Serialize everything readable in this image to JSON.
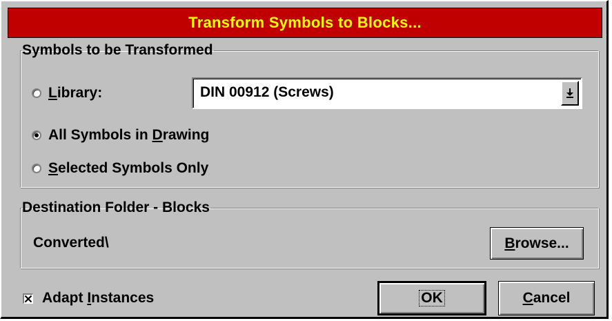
{
  "window": {
    "title": "Transform Symbols to Blocks..."
  },
  "symbols_group": {
    "legend": "Symbols to be Transformed",
    "options": [
      {
        "prefix": "",
        "underline": "L",
        "suffix": "ibrary:",
        "selected": false
      },
      {
        "prefix": "All Symbols in ",
        "underline": "D",
        "suffix": "rawing",
        "selected": true
      },
      {
        "prefix": "",
        "underline": "S",
        "suffix": "elected Symbols Only",
        "selected": false
      }
    ],
    "library_select": {
      "value": "DIN 00912 (Screws)"
    }
  },
  "destination_group": {
    "legend": "Destination Folder - Blocks",
    "path": "Converted\\",
    "browse_button": {
      "underline": "B",
      "suffix": "rowse..."
    }
  },
  "adapt_instances": {
    "prefix": "Adapt ",
    "underline": "I",
    "suffix": "nstances",
    "checked": true
  },
  "buttons": {
    "ok": "OK",
    "cancel_underline": "C",
    "cancel_suffix": "ancel"
  },
  "colors": {
    "title_bar": "#c00000",
    "title_text": "#ffff00",
    "dialog_face": "#c0c0c0"
  }
}
